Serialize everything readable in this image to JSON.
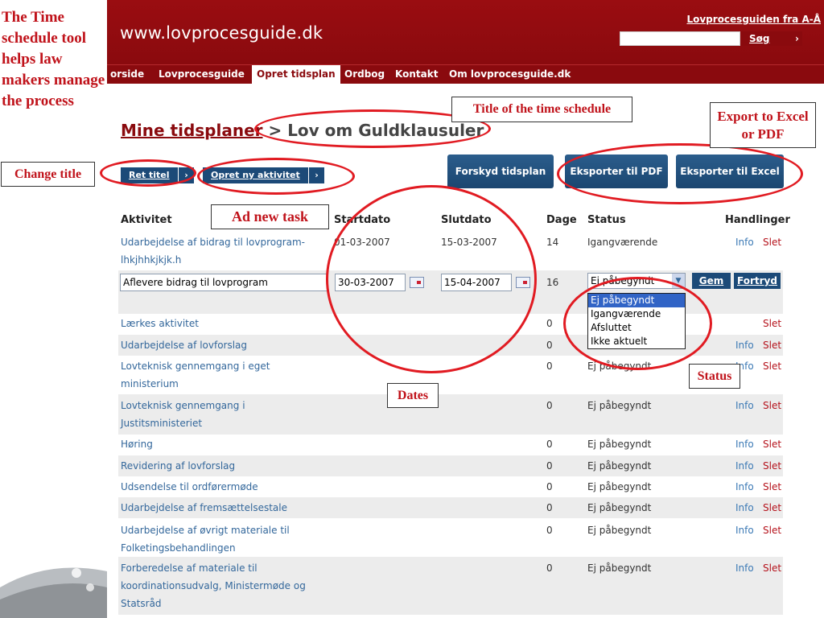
{
  "caption": "The Time schedule tool helps law makers manage the process",
  "site": {
    "title": "www.lovprocesguide.dk",
    "top_link": "Lovprocesguiden fra A-Å",
    "search_button": "Søg",
    "search_arrow": "›"
  },
  "nav": [
    "orside",
    "Lovprocesguide",
    "Opret tidsplan",
    "Ordbog",
    "Kontakt",
    "Om lovprocesguide.dk"
  ],
  "page": {
    "title_link": "Mine tidsplaner",
    "title_sep": " > ",
    "title_rest": "Lov om Guldklausuler"
  },
  "buttons": {
    "change_title": "Ret titel",
    "new_activity": "Opret ny aktivitet",
    "shift_schedule": "Forskyd tidsplan",
    "export_pdf": "Eksporter til PDF",
    "export_excel": "Eksporter til Excel",
    "arrow": "›",
    "save": "Gem",
    "cancel": "Fortryd"
  },
  "table": {
    "headers": [
      "Aktivitet",
      "Startdato",
      "Slutdato",
      "Dage",
      "Status",
      "Handlinger"
    ],
    "rows": [
      {
        "activity": "Udarbejdelse af bidrag til lovprogram-lhkjhhkjkjk.h",
        "start": "01-03-2007",
        "end": "15-03-2007",
        "days": "14",
        "status": "Igangværende",
        "info": "Info",
        "slet": "Slet"
      },
      {
        "activity": "Lærkes aktivitet",
        "start": "",
        "end": "",
        "days": "0",
        "status": "",
        "info": "",
        "slet": "Slet"
      },
      {
        "activity": "Udarbejdelse af lovforslag",
        "start": "",
        "end": "",
        "days": "0",
        "status": "",
        "info": "Info",
        "slet": "Slet"
      },
      {
        "activity": "Lovteknisk gennemgang i eget ministerium",
        "start": "",
        "end": "",
        "days": "0",
        "status": "Ej påbegyndt",
        "info": "Info",
        "slet": "Slet"
      },
      {
        "activity": "Lovteknisk gennemgang i Justitsministeriet",
        "start": "",
        "end": "",
        "days": "0",
        "status": "Ej påbegyndt",
        "info": "Info",
        "slet": "Slet"
      },
      {
        "activity": "Høring",
        "start": "",
        "end": "",
        "days": "0",
        "status": "Ej påbegyndt",
        "info": "Info",
        "slet": "Slet"
      },
      {
        "activity": "Revidering af lovforslag",
        "start": "",
        "end": "",
        "days": "0",
        "status": "Ej påbegyndt",
        "info": "Info",
        "slet": "Slet"
      },
      {
        "activity": "Udsendelse til ordførermøde",
        "start": "",
        "end": "",
        "days": "0",
        "status": "Ej påbegyndt",
        "info": "Info",
        "slet": "Slet"
      },
      {
        "activity": "Udarbejdelse af fremsættelsestale",
        "start": "",
        "end": "",
        "days": "0",
        "status": "Ej påbegyndt",
        "info": "Info",
        "slet": "Slet"
      },
      {
        "activity": "Udarbejdelse af øvrigt materiale til Folketingsbehandlingen",
        "start": "",
        "end": "",
        "days": "0",
        "status": "Ej påbegyndt",
        "info": "Info",
        "slet": "Slet"
      },
      {
        "activity": "Forberedelse af materiale til koordinationsudvalg, Ministermøde og Statsråd",
        "start": "",
        "end": "",
        "days": "0",
        "status": "Ej påbegyndt",
        "info": "Info",
        "slet": "Slet"
      }
    ],
    "edit_row": {
      "activity": "Aflevere bidrag til lovprogram",
      "start": "30-03-2007",
      "end": "15-04-2007",
      "days": "16",
      "status_selected": "Ej påbegyndt",
      "status_options": [
        "Ej påbegyndt",
        "Igangværende",
        "Afsluttet",
        "Ikke aktuelt"
      ]
    }
  },
  "annotations": {
    "change_title": "Change title",
    "ad_new_task": "Ad new task",
    "title_of_schedule": "Title of the time schedule",
    "export": "Export to Excel or PDF",
    "dates": "Dates",
    "status": "Status"
  },
  "colors": {
    "brand_red": "#8a0a0e",
    "button_blue": "#1c4a78",
    "annotation_red": "#e11b22",
    "link_blue": "#33679b"
  }
}
